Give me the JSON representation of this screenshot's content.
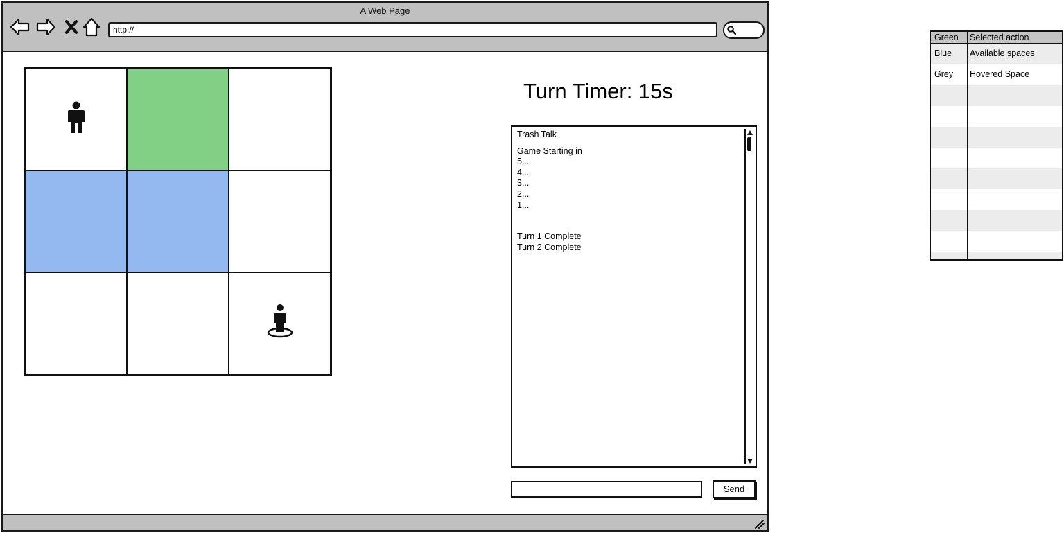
{
  "window": {
    "title": "A Web Page",
    "url": "http://"
  },
  "icons": {
    "back": "arrow-left-icon",
    "forward": "arrow-right-icon",
    "stop": "close-icon",
    "home": "home-icon",
    "search": "search-icon",
    "player": "person-icon",
    "player_selected": "person-on-ring-icon",
    "resize": "resize-grip-icon"
  },
  "colors": {
    "selected": "#81d085",
    "available": "#93b9f0",
    "hovered": "#c8c8c8",
    "chrome": "#c0c0c0"
  },
  "board": {
    "cells": [
      {
        "state": "empty",
        "piece": "player"
      },
      {
        "state": "selected",
        "piece": ""
      },
      {
        "state": "empty",
        "piece": ""
      },
      {
        "state": "available",
        "piece": ""
      },
      {
        "state": "available",
        "piece": ""
      },
      {
        "state": "empty",
        "piece": ""
      },
      {
        "state": "empty",
        "piece": ""
      },
      {
        "state": "empty",
        "piece": ""
      },
      {
        "state": "empty",
        "piece": "player_selected"
      }
    ]
  },
  "turn_timer": "Turn Timer: 15s",
  "chat": {
    "lines": [
      "Trash Talk",
      "Game Starting in",
      "5...",
      "4...",
      "3...",
      "2...",
      "1...",
      "Turn 1 Complete",
      "Turn 2 Complete"
    ],
    "input_value": "",
    "send_label": "Send"
  },
  "legend": {
    "header": [
      "Green",
      "Selected action"
    ],
    "rows": [
      [
        "Blue",
        "Available spaces"
      ],
      [
        "Grey",
        "Hovered Space"
      ]
    ]
  }
}
